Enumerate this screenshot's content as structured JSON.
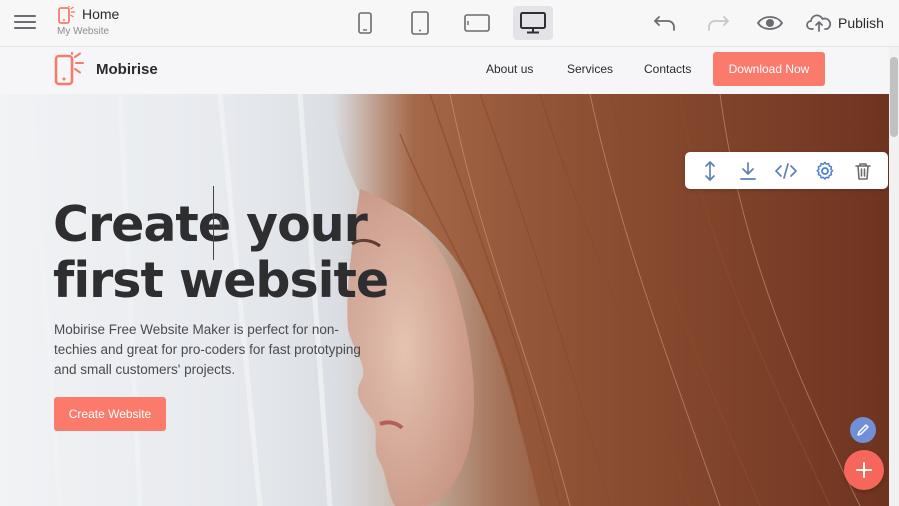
{
  "editor": {
    "page_title": "Home",
    "site_name": "My Website",
    "publish_label": "Publish",
    "devices": [
      "phone-icon",
      "tablet-icon",
      "tablet-landscape-icon",
      "desktop-icon"
    ],
    "active_device": "desktop"
  },
  "site": {
    "brand": "Mobirise",
    "nav": [
      {
        "label": "About us"
      },
      {
        "label": "Services"
      },
      {
        "label": "Contacts"
      }
    ],
    "nav_cta": "Download Now"
  },
  "hero": {
    "title_line1": "Create your",
    "title_line2": "first website",
    "description": "Mobirise Free Website Maker is perfect for non-techies and great for pro-coders for fast prototyping and small customers' projects.",
    "button": "Create Website"
  },
  "block_toolbar": [
    "move-icon",
    "download-icon",
    "code-icon",
    "gear-icon",
    "trash-icon"
  ],
  "colors": {
    "accent": "#fa7a6c",
    "fab_add": "#f7665a",
    "fab_edit": "#6f8fd6",
    "toolbar_icon": "#4a7bd0"
  }
}
